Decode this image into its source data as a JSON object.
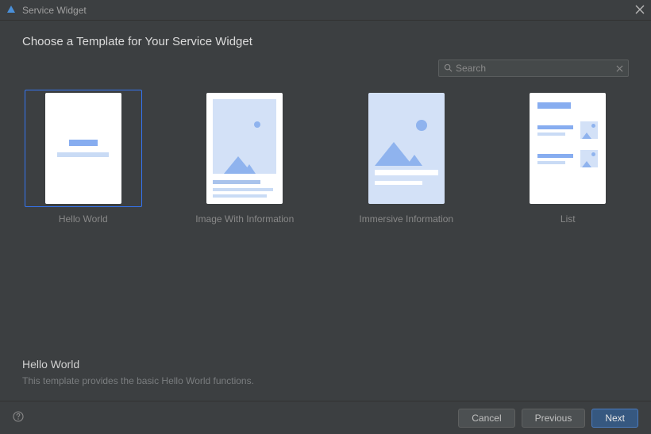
{
  "window": {
    "title": "Service Widget"
  },
  "page": {
    "title": "Choose a Template for Your Service Widget"
  },
  "search": {
    "placeholder": "Search"
  },
  "templates": [
    {
      "name": "Hello World",
      "selected": true
    },
    {
      "name": "Image With Information",
      "selected": false
    },
    {
      "name": "Immersive Information",
      "selected": false
    },
    {
      "name": "List",
      "selected": false
    }
  ],
  "detail": {
    "heading": "Hello World",
    "description": "This template provides the basic Hello World functions."
  },
  "buttons": {
    "cancel": "Cancel",
    "previous": "Previous",
    "next": "Next"
  }
}
